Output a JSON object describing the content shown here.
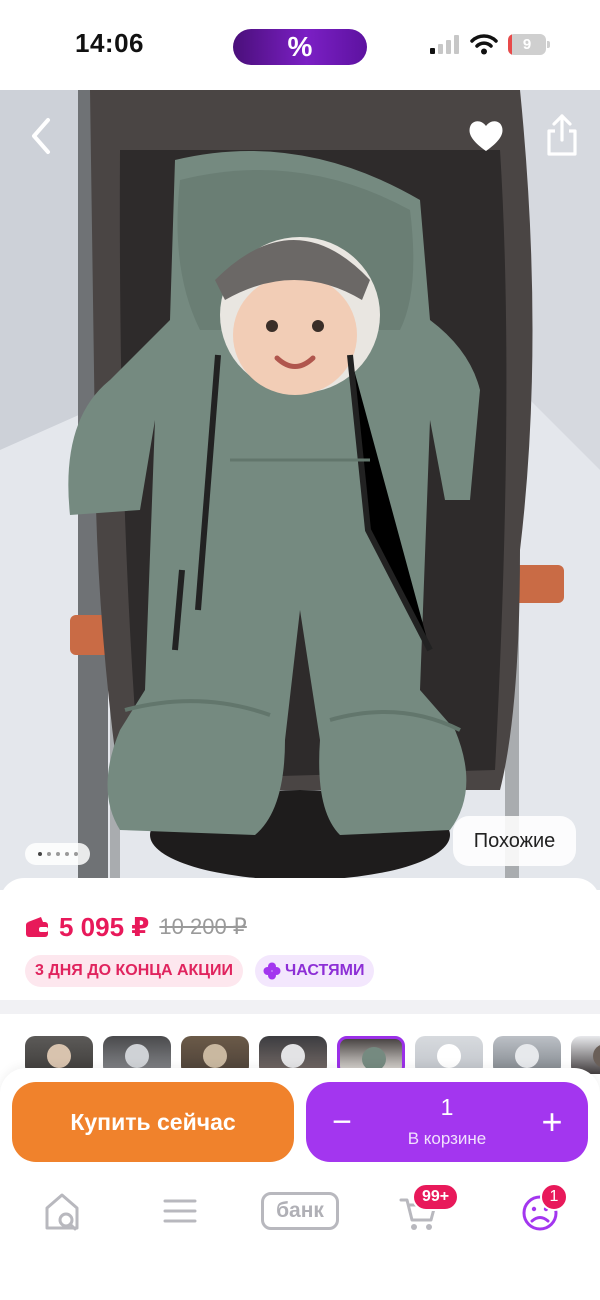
{
  "status_bar": {
    "time": "14:06",
    "promo_label": "%",
    "battery_level": "9",
    "battery_fraction": 0.09,
    "signal_bars_active": 1,
    "icons": [
      "signal-icon",
      "wifi-icon",
      "battery-icon"
    ]
  },
  "product": {
    "gallery": {
      "similar_label": "Похожие",
      "page_count": 5,
      "active_page": 1,
      "icons": [
        "back-arrow-icon",
        "heart-icon",
        "share-icon"
      ]
    },
    "price_current": "5 095 ₽",
    "price_old": "10 200 ₽",
    "badge_sale": "3 ДНЯ ДО КОНЦА АКЦИИ",
    "badge_installments": "ЧАСТЯМИ",
    "thumbnails_count": 8,
    "thumbnail_selected": 5
  },
  "actions": {
    "buy_now": "Купить сейчас",
    "minus": "−",
    "plus": "+",
    "quantity": "1",
    "in_cart": "В корзине"
  },
  "tabbar": {
    "bank_label": "банк",
    "cart_badge": "99+",
    "profile_badge": "1",
    "icons": [
      "home-search-icon",
      "catalog-menu-icon",
      "bank-icon",
      "cart-icon",
      "profile-icon"
    ]
  },
  "colors": {
    "price": "#e8195a",
    "buy_button": "#f0822c",
    "cart_control": "#a336ef",
    "promo_pill": "#6a17b0",
    "sale_badge_text": "#e0245e",
    "installments_text": "#8d2fd6"
  }
}
